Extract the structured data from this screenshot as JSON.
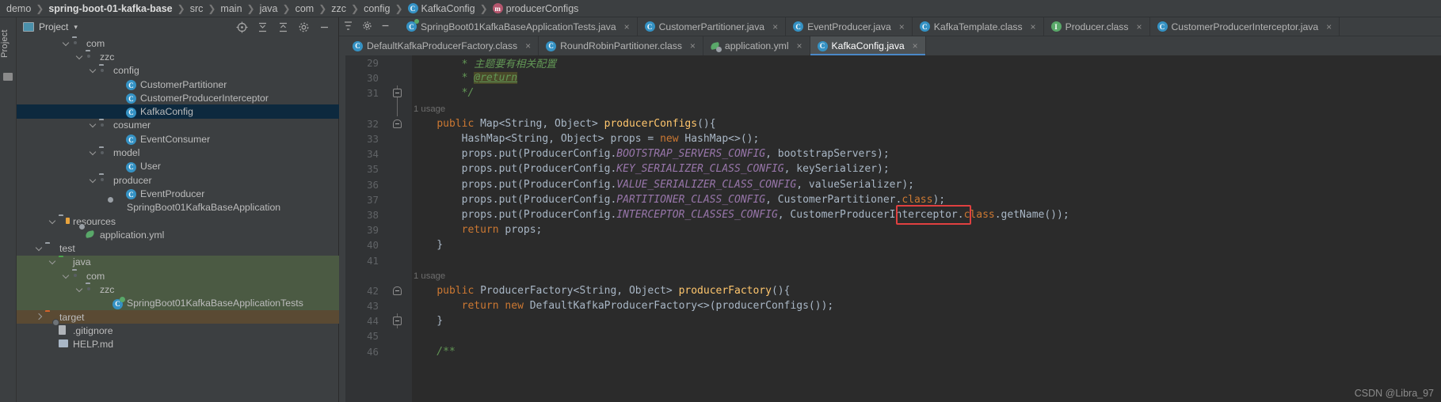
{
  "breadcrumb": {
    "items": [
      {
        "label": "demo",
        "bold": false,
        "icon": null
      },
      {
        "label": "spring-boot-01-kafka-base",
        "bold": true,
        "icon": null
      },
      {
        "label": "src",
        "bold": false,
        "icon": null
      },
      {
        "label": "main",
        "bold": false,
        "icon": null
      },
      {
        "label": "java",
        "bold": false,
        "icon": null
      },
      {
        "label": "com",
        "bold": false,
        "icon": null
      },
      {
        "label": "zzc",
        "bold": false,
        "icon": null
      },
      {
        "label": "config",
        "bold": false,
        "icon": null
      },
      {
        "label": "KafkaConfig",
        "bold": false,
        "icon": "class-icon",
        "icon_letter": "C"
      },
      {
        "label": "producerConfigs",
        "bold": false,
        "icon": "method-icon",
        "icon_letter": "m"
      }
    ]
  },
  "tool_strip": {
    "label": "Project"
  },
  "project_panel": {
    "title": "Project",
    "caret": "▾",
    "actions": [
      "locate-icon",
      "collapse-all-icon",
      "expand-icon",
      "settings-icon",
      "hide-icon"
    ],
    "tree": [
      {
        "label": "com",
        "indent": 5,
        "twisty": "open",
        "icon": "package-folder",
        "state": "normal"
      },
      {
        "label": "zzc",
        "indent": 6,
        "twisty": "open",
        "icon": "package-folder",
        "state": "normal"
      },
      {
        "label": "config",
        "indent": 7,
        "twisty": "open",
        "icon": "package-folder",
        "state": "normal"
      },
      {
        "label": "CustomerPartitioner",
        "indent": 9,
        "twisty": "none",
        "icon": "class-icon",
        "state": "normal"
      },
      {
        "label": "CustomerProducerInterceptor",
        "indent": 9,
        "twisty": "none",
        "icon": "class-icon",
        "state": "normal"
      },
      {
        "label": "KafkaConfig",
        "indent": 9,
        "twisty": "none",
        "icon": "class-icon",
        "state": "selected"
      },
      {
        "label": "cosumer",
        "indent": 7,
        "twisty": "open",
        "icon": "package-folder",
        "state": "normal"
      },
      {
        "label": "EventConsumer",
        "indent": 9,
        "twisty": "none",
        "icon": "class-icon",
        "state": "normal"
      },
      {
        "label": "model",
        "indent": 7,
        "twisty": "open",
        "icon": "package-folder",
        "state": "normal"
      },
      {
        "label": "User",
        "indent": 9,
        "twisty": "none",
        "icon": "class-icon",
        "state": "normal"
      },
      {
        "label": "producer",
        "indent": 7,
        "twisty": "open",
        "icon": "package-folder",
        "state": "normal"
      },
      {
        "label": "EventProducer",
        "indent": 9,
        "twisty": "none",
        "icon": "class-icon",
        "state": "normal"
      },
      {
        "label": "SpringBoot01KafkaBaseApplication",
        "indent": 8,
        "twisty": "none",
        "icon": "spring-boot-icon",
        "state": "normal"
      },
      {
        "label": "resources",
        "indent": 4,
        "twisty": "open",
        "icon": "resources-folder",
        "state": "normal"
      },
      {
        "label": "application.yml",
        "indent": 6,
        "twisty": "none",
        "icon": "yaml-spring-icon",
        "state": "normal"
      },
      {
        "label": "test",
        "indent": 3,
        "twisty": "open",
        "icon": "plain-folder",
        "state": "normal"
      },
      {
        "label": "java",
        "indent": 4,
        "twisty": "open",
        "icon": "source-folder",
        "state": "test-source"
      },
      {
        "label": "com",
        "indent": 5,
        "twisty": "open",
        "icon": "package-folder",
        "state": "test-source"
      },
      {
        "label": "zzc",
        "indent": 6,
        "twisty": "open",
        "icon": "package-folder",
        "state": "test-source"
      },
      {
        "label": "SpringBoot01KafkaBaseApplicationTests",
        "indent": 8,
        "twisty": "none",
        "icon": "test-class-icon",
        "state": "test-source"
      },
      {
        "label": "target",
        "indent": 3,
        "twisty": "closed",
        "icon": "target-folder",
        "state": "excluded"
      },
      {
        "label": ".gitignore",
        "indent": 4,
        "twisty": "none",
        "icon": "gitignore-icon",
        "state": "normal"
      },
      {
        "label": "HELP.md",
        "indent": 4,
        "twisty": "none",
        "icon": "markdown-icon",
        "state": "normal"
      }
    ]
  },
  "editor": {
    "tabs_row1": [
      {
        "label": "SpringBoot01KafkaBaseApplicationTests.java",
        "icon": "test-class-icon",
        "icon_letter": "C",
        "active": false,
        "closable": true
      },
      {
        "label": "CustomerPartitioner.java",
        "icon": "class-icon",
        "icon_letter": "C",
        "active": false,
        "closable": true
      },
      {
        "label": "EventProducer.java",
        "icon": "class-icon",
        "icon_letter": "C",
        "active": false,
        "closable": true
      },
      {
        "label": "KafkaTemplate.class",
        "icon": "class-icon",
        "icon_letter": "C",
        "active": false,
        "closable": true
      },
      {
        "label": "Producer.class",
        "icon": "interface-icon",
        "icon_letter": "I",
        "active": false,
        "closable": true
      },
      {
        "label": "CustomerProducerInterceptor.java",
        "icon": "class-icon",
        "icon_letter": "C",
        "active": false,
        "closable": true
      }
    ],
    "tabs_row2": [
      {
        "label": "DefaultKafkaProducerFactory.class",
        "icon": "class-icon",
        "icon_letter": "C",
        "active": false,
        "closable": true
      },
      {
        "label": "RoundRobinPartitioner.class",
        "icon": "class-icon",
        "icon_letter": "C",
        "active": false,
        "closable": true
      },
      {
        "label": "application.yml",
        "icon": "yaml-spring-icon",
        "icon_letter": "",
        "active": false,
        "closable": true
      },
      {
        "label": "KafkaConfig.java",
        "icon": "class-icon",
        "icon_letter": "C",
        "active": true,
        "closable": true
      }
    ],
    "toolbar_icons": [
      "settings-icon",
      "hide-icon"
    ],
    "code_lines": [
      {
        "num": "29",
        "fold": "none",
        "usage": null,
        "clipped": true,
        "tokens": [
          {
            "t": "        * 主题要有相关配置",
            "c": "cmt"
          }
        ]
      },
      {
        "num": "30",
        "fold": "none",
        "usage": null,
        "tokens": [
          {
            "t": "        * ",
            "c": "cmt"
          },
          {
            "t": "@return",
            "c": "cmt-tag"
          }
        ]
      },
      {
        "num": "31",
        "fold": "minus",
        "usage": null,
        "tokens": [
          {
            "t": "        */",
            "c": "cmt"
          }
        ]
      },
      {
        "num": "",
        "fold": "line",
        "usage": "1 usage",
        "tokens": []
      },
      {
        "num": "32",
        "fold": "minus-round",
        "usage": null,
        "tokens": [
          {
            "t": "    ",
            "c": "pun"
          },
          {
            "t": "public",
            "c": "kw"
          },
          {
            "t": " Map<String, Object> ",
            "c": "type"
          },
          {
            "t": "producerConfigs",
            "c": "meth"
          },
          {
            "t": "(){",
            "c": "pun"
          }
        ]
      },
      {
        "num": "33",
        "fold": "none",
        "usage": null,
        "tokens": [
          {
            "t": "        HashMap<String, Object> props = ",
            "c": "var"
          },
          {
            "t": "new",
            "c": "kw"
          },
          {
            "t": " HashMap<>();",
            "c": "var"
          }
        ]
      },
      {
        "num": "34",
        "fold": "none",
        "usage": null,
        "tokens": [
          {
            "t": "        props.put(ProducerConfig.",
            "c": "var"
          },
          {
            "t": "BOOTSTRAP_SERVERS_CONFIG",
            "c": "fld"
          },
          {
            "t": ", bootstrapServers);",
            "c": "var"
          }
        ]
      },
      {
        "num": "35",
        "fold": "none",
        "usage": null,
        "tokens": [
          {
            "t": "        props.put(ProducerConfig.",
            "c": "var"
          },
          {
            "t": "KEY_SERIALIZER_CLASS_CONFIG",
            "c": "fld"
          },
          {
            "t": ", keySerializer);",
            "c": "var"
          }
        ]
      },
      {
        "num": "36",
        "fold": "none",
        "usage": null,
        "tokens": [
          {
            "t": "        props.put(ProducerConfig.",
            "c": "var"
          },
          {
            "t": "VALUE_SERIALIZER_CLASS_CONFIG",
            "c": "fld"
          },
          {
            "t": ", valueSerializer);",
            "c": "var"
          }
        ]
      },
      {
        "num": "37",
        "fold": "none",
        "usage": null,
        "tokens": [
          {
            "t": "        props.put(ProducerConfig.",
            "c": "var"
          },
          {
            "t": "PARTITIONER_CLASS_CONFIG",
            "c": "fld"
          },
          {
            "t": ", CustomerPartitioner.",
            "c": "var"
          },
          {
            "t": "class",
            "c": "kw"
          },
          {
            "t": ");",
            "c": "var"
          }
        ]
      },
      {
        "num": "38",
        "fold": "none",
        "usage": null,
        "highlighted": true,
        "tokens": [
          {
            "t": "        props.put(ProducerConfig.",
            "c": "var"
          },
          {
            "t": "INTERCEPTOR_CLASSES_CONFIG",
            "c": "fld"
          },
          {
            "t": ", CustomerProducerInterceptor.",
            "c": "var"
          },
          {
            "t": "class",
            "c": "kw"
          },
          {
            "t": ".getName());",
            "c": "var"
          }
        ]
      },
      {
        "num": "39",
        "fold": "none",
        "usage": null,
        "tokens": [
          {
            "t": "        ",
            "c": "pun"
          },
          {
            "t": "return",
            "c": "kw"
          },
          {
            "t": " props;",
            "c": "var"
          }
        ]
      },
      {
        "num": "40",
        "fold": "none",
        "usage": null,
        "tokens": [
          {
            "t": "    }",
            "c": "pun"
          }
        ]
      },
      {
        "num": "41",
        "fold": "none",
        "usage": null,
        "tokens": []
      },
      {
        "num": "",
        "fold": "none",
        "usage": "1 usage",
        "tokens": []
      },
      {
        "num": "42",
        "fold": "minus-round",
        "usage": null,
        "tokens": [
          {
            "t": "    ",
            "c": "pun"
          },
          {
            "t": "public",
            "c": "kw"
          },
          {
            "t": " ProducerFactory<String, Object> ",
            "c": "type"
          },
          {
            "t": "producerFactory",
            "c": "meth"
          },
          {
            "t": "(){",
            "c": "pun"
          }
        ]
      },
      {
        "num": "43",
        "fold": "none",
        "usage": null,
        "tokens": [
          {
            "t": "        ",
            "c": "pun"
          },
          {
            "t": "return new",
            "c": "kw"
          },
          {
            "t": " DefaultKafkaProducerFactory<>(producerConfigs());",
            "c": "var"
          }
        ]
      },
      {
        "num": "44",
        "fold": "minus",
        "usage": null,
        "tokens": [
          {
            "t": "    }",
            "c": "pun"
          }
        ]
      },
      {
        "num": "45",
        "fold": "none",
        "usage": null,
        "tokens": []
      },
      {
        "num": "46",
        "fold": "none",
        "usage": null,
        "tokens": [
          {
            "t": "    /**",
            "c": "cmt"
          }
        ]
      }
    ],
    "annotation": {
      "type": "red-rectangle",
      "around": ".getName());"
    }
  },
  "watermark": "CSDN @Libra_97"
}
